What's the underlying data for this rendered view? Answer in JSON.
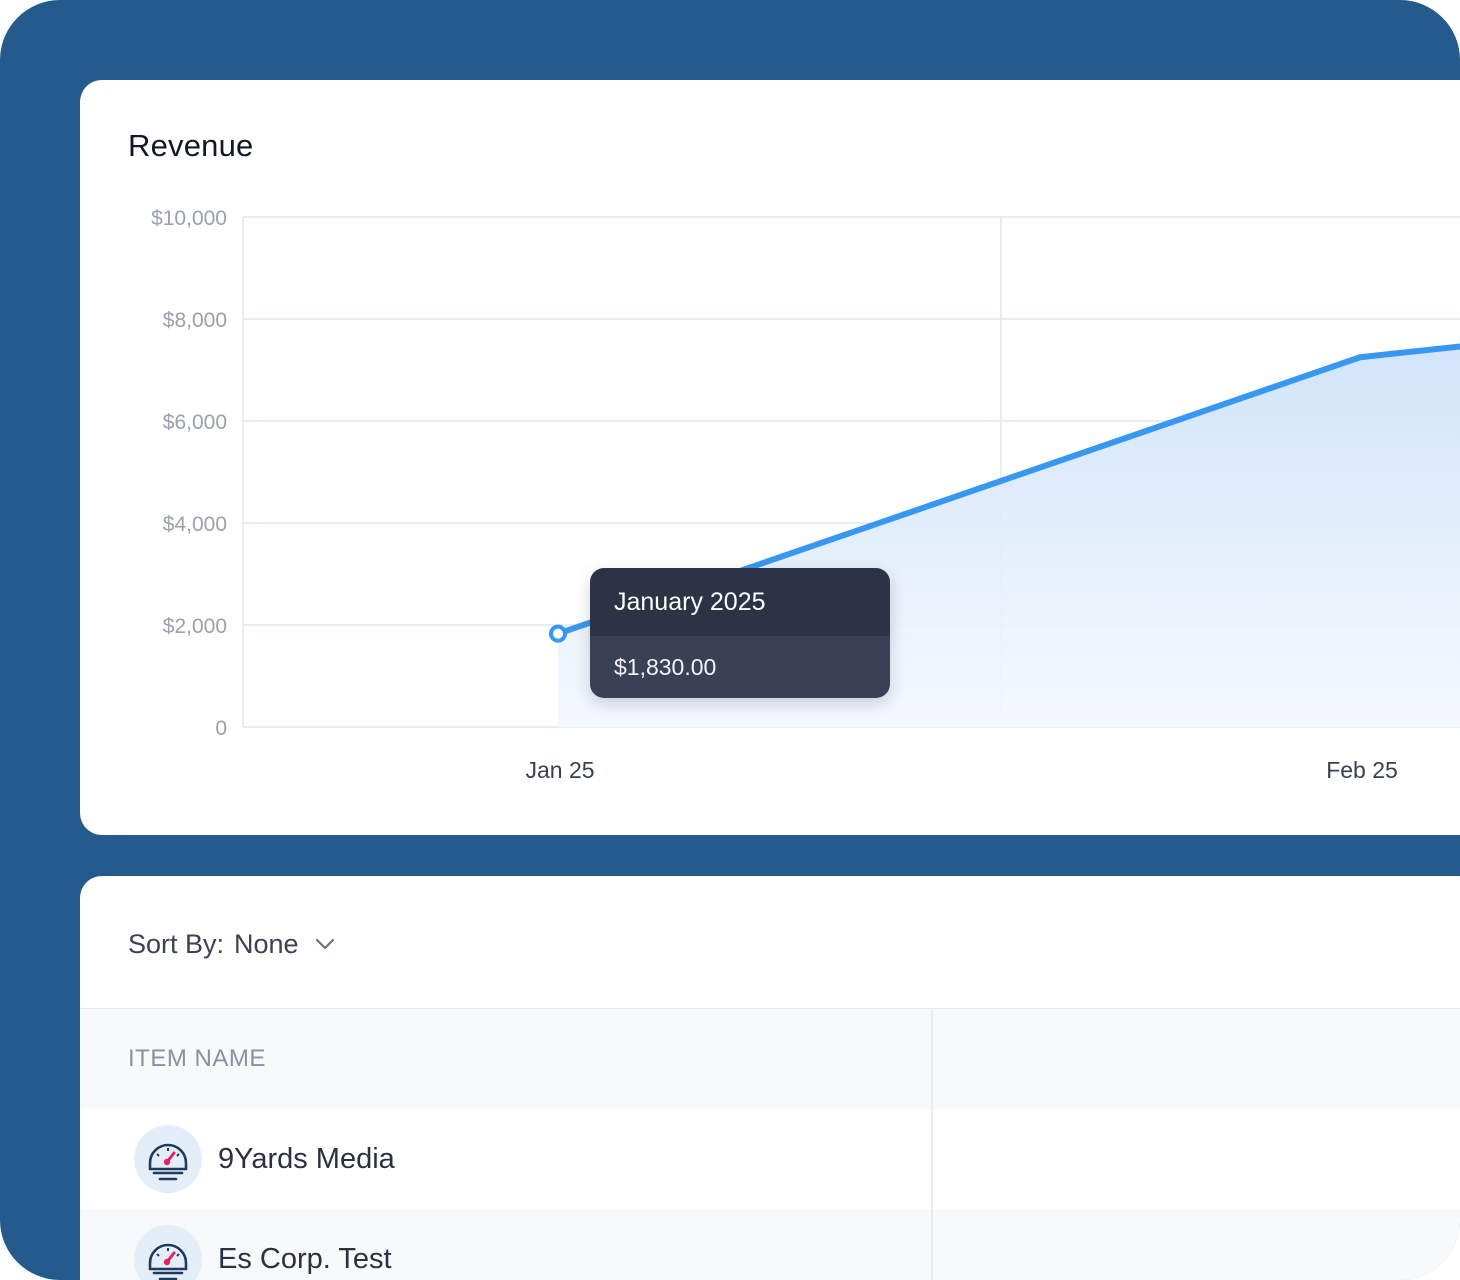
{
  "chart": {
    "title": "Revenue"
  },
  "chart_data": {
    "type": "area",
    "title": "Revenue",
    "xlabel": "",
    "ylabel": "",
    "x_ticks": [
      "Jan 25",
      "Feb 25"
    ],
    "y_ticks": [
      "$10,000",
      "$8,000",
      "$6,000",
      "$4,000",
      "$2,000",
      "0"
    ],
    "ylim": [
      0,
      10000
    ],
    "series": [
      {
        "points": [
          {
            "x": "Jan 25",
            "y": 1830
          },
          {
            "x": "Feb 25",
            "y": 7250
          }
        ]
      }
    ],
    "grid": true,
    "line_color": "#3897f0",
    "fill_color": "#d6e8fb"
  },
  "tooltip": {
    "title": "January 2025",
    "value": "$1,830.00"
  },
  "sort": {
    "label": "Sort By:",
    "value": "None"
  },
  "table": {
    "header_name": "ITEM NAME",
    "rows": [
      {
        "name": "9Yards Media",
        "icon": "speedometer-icon"
      },
      {
        "name": "Es Corp. Test",
        "icon": "speedometer-icon"
      }
    ]
  }
}
